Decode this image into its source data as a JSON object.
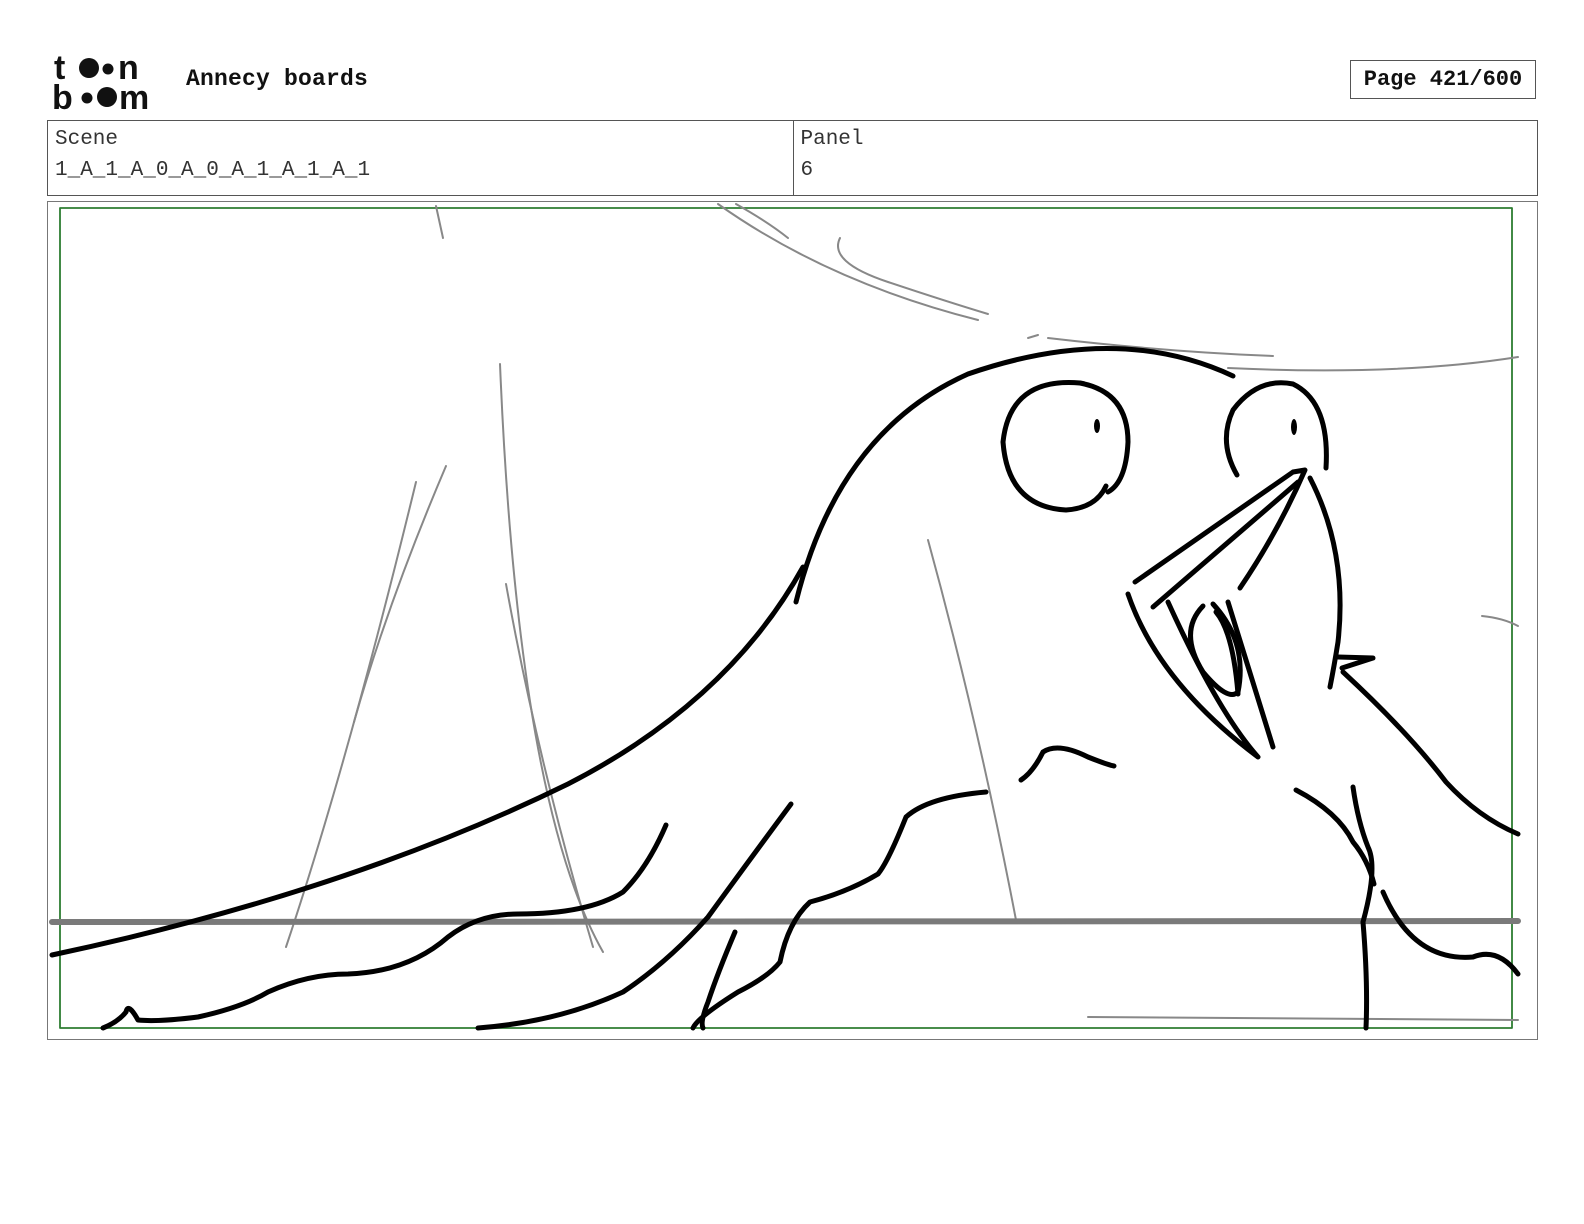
{
  "header": {
    "project_title": "Annecy boards",
    "page_label": "Page 421/600"
  },
  "info": {
    "scene_label": "Scene",
    "scene_value": "1_A_1_A_0_A_0_A_1_A_1_A_1",
    "panel_label": "Panel",
    "panel_value": "6"
  },
  "colors": {
    "safe_frame": "#2e7d32",
    "ink": "#000000",
    "sketch_gray": "#888888",
    "border": "#555555"
  },
  "icons": {
    "logo": "toonboom-logo"
  }
}
